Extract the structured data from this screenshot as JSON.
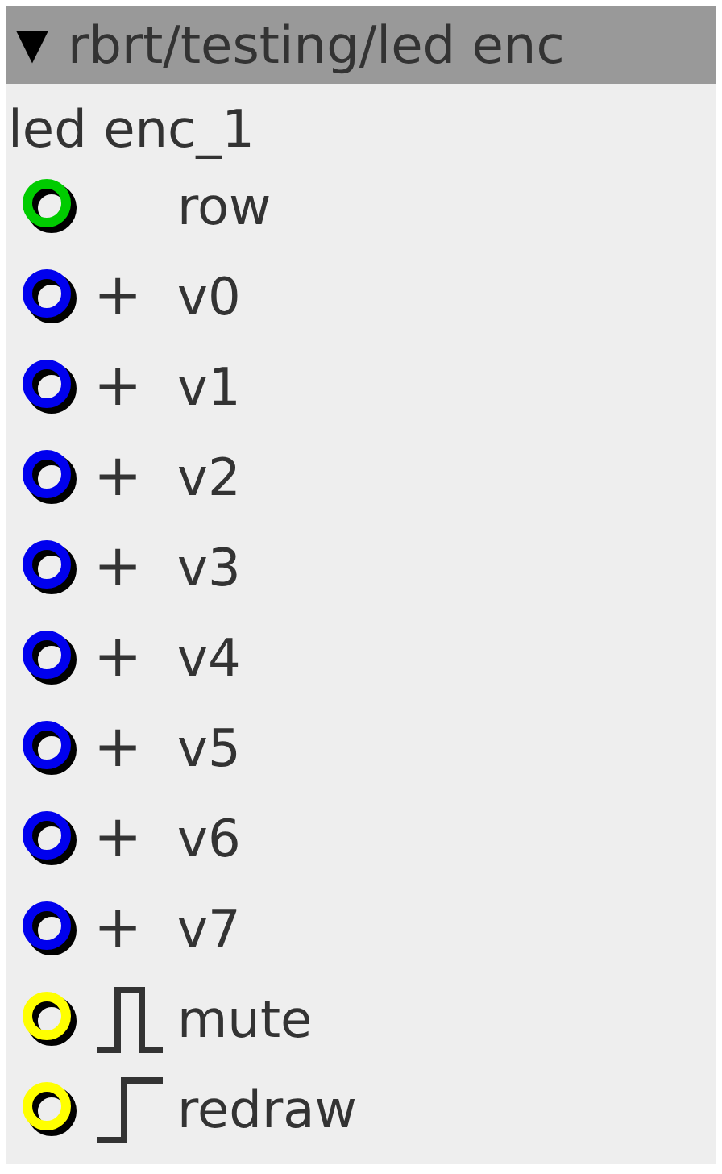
{
  "header": {
    "toggle": "▼",
    "title": "rbrt/testing/led enc"
  },
  "node": {
    "name": "led enc_1"
  },
  "ports": [
    {
      "kind": "plain",
      "color": "#00cc00",
      "label": "row"
    },
    {
      "kind": "add",
      "symbol": "+",
      "color": "#0000ee",
      "label": "v0"
    },
    {
      "kind": "add",
      "symbol": "+",
      "color": "#0000ee",
      "label": "v1"
    },
    {
      "kind": "add",
      "symbol": "+",
      "color": "#0000ee",
      "label": "v2"
    },
    {
      "kind": "add",
      "symbol": "+",
      "color": "#0000ee",
      "label": "v3"
    },
    {
      "kind": "add",
      "symbol": "+",
      "color": "#0000ee",
      "label": "v4"
    },
    {
      "kind": "add",
      "symbol": "+",
      "color": "#0000ee",
      "label": "v5"
    },
    {
      "kind": "add",
      "symbol": "+",
      "color": "#0000ee",
      "label": "v6"
    },
    {
      "kind": "add",
      "symbol": "+",
      "color": "#0000ee",
      "label": "v7"
    },
    {
      "kind": "pulse",
      "color": "#ffff00",
      "label": "mute"
    },
    {
      "kind": "step",
      "color": "#ffff00",
      "label": "redraw"
    }
  ]
}
